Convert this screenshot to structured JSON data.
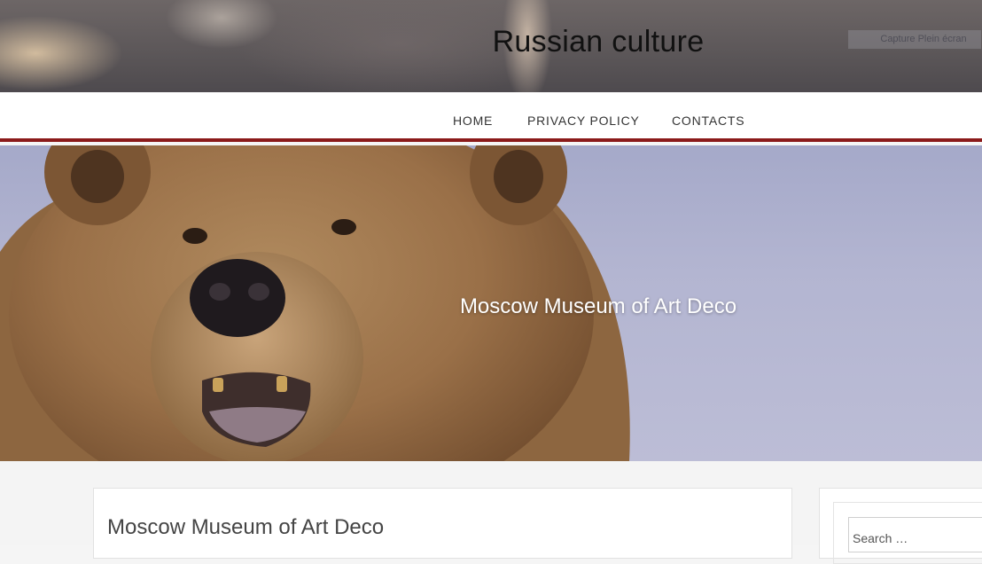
{
  "header": {
    "site_title": "Russian culture",
    "capture_button_label": "Capture Plein écran"
  },
  "nav": {
    "items": [
      {
        "label": "HOME"
      },
      {
        "label": "PRIVACY POLICY"
      },
      {
        "label": "CONTACTS"
      }
    ],
    "accent_color": "#8b1a1a"
  },
  "hero": {
    "caption": "Moscow Museum of Art Deco",
    "image_subject": "brown bear close-up"
  },
  "post": {
    "title": "Moscow Museum of Art Deco"
  },
  "sidebar": {
    "search_placeholder": "Search …"
  }
}
